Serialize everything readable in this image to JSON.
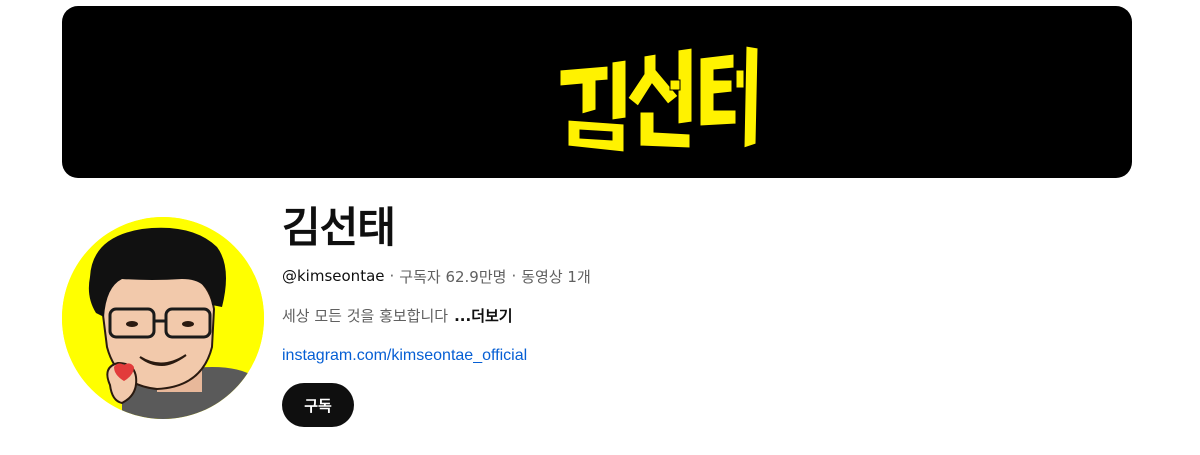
{
  "banner": {
    "logo_text": "김선태",
    "colors": {
      "background": "#000000",
      "logo_fill": "#fff200"
    }
  },
  "avatar": {
    "icon": "caricature-avatar",
    "colors": {
      "background": "#ffff00"
    }
  },
  "channel": {
    "name": "김선태",
    "handle": "@kimseontae",
    "separator": "·",
    "subscribers": "구독자 62.9만명",
    "videos": "동영상 1개",
    "description": "세상 모든 것을 홍보합니다",
    "more_label": "...더보기",
    "link": "instagram.com/kimseontae_official"
  },
  "actions": {
    "subscribe_label": "구독"
  },
  "colors": {
    "text_primary": "#0f0f0f",
    "text_secondary": "#606060",
    "link": "#065fd4",
    "button_bg": "#0f0f0f",
    "button_text": "#ffffff"
  }
}
